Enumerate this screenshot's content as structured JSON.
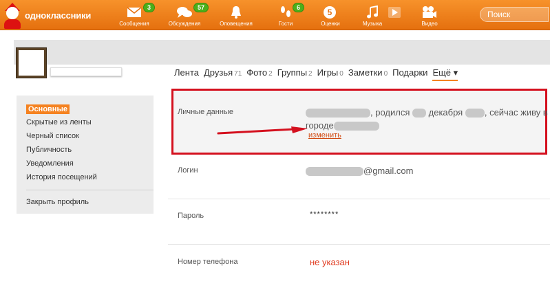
{
  "brand": {
    "name": "одноклассники"
  },
  "nav": [
    {
      "label": "Сообщения",
      "icon": "envelope-icon",
      "badge": "3"
    },
    {
      "label": "Обсуждения",
      "icon": "chat-bubbles-icon",
      "badge": "57"
    },
    {
      "label": "Оповещения",
      "icon": "bell-icon",
      "badge": ""
    },
    {
      "label": "Гости",
      "icon": "footprints-icon",
      "badge": "6"
    },
    {
      "label": "Оценки",
      "icon": "rating-five-icon",
      "badge": ""
    },
    {
      "label": "Музыка",
      "icon": "music-note-icon",
      "badge": ""
    },
    {
      "label": "Видео",
      "icon": "video-camera-icon",
      "badge": ""
    }
  ],
  "search": {
    "placeholder": "Поиск"
  },
  "tabs": [
    {
      "label": "Лента",
      "count": ""
    },
    {
      "label": "Друзья",
      "count": "71"
    },
    {
      "label": "Фото",
      "count": "2"
    },
    {
      "label": "Группы",
      "count": "2"
    },
    {
      "label": "Игры",
      "count": "0"
    },
    {
      "label": "Заметки",
      "count": "0"
    },
    {
      "label": "Подарки",
      "count": ""
    },
    {
      "label": "Ещё ▾",
      "count": ""
    }
  ],
  "sidebar": {
    "items": [
      {
        "label": "Основные",
        "active": true
      },
      {
        "label": "Скрытые из ленты"
      },
      {
        "label": "Черный список"
      },
      {
        "label": "Публичность"
      },
      {
        "label": "Уведомления"
      },
      {
        "label": "История посещений"
      }
    ],
    "close_profile": "Закрыть профиль"
  },
  "personal": {
    "label": "Личные данные",
    "born": ", родился",
    "month": "декабря",
    "living": ", сейчас живу в",
    "city_prefix": "городе",
    "edit": "изменить"
  },
  "login": {
    "label": "Логин",
    "email_suffix": "@gmail.com"
  },
  "password": {
    "label": "Пароль",
    "value": "********"
  },
  "phone": {
    "label": "Номер телефона",
    "value": "не указан"
  },
  "colors": {
    "accent": "#f58220",
    "highlight": "#d4101e",
    "badge": "#4caf1a"
  }
}
